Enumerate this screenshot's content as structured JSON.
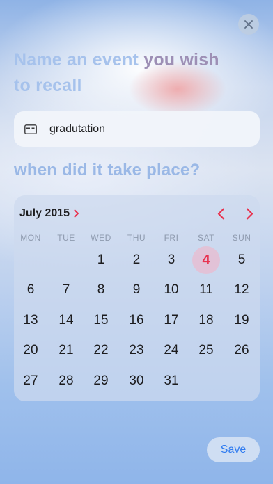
{
  "header": {
    "title_part1": "Name an event ",
    "title_part2": "you wish",
    "title_part3": "to recall"
  },
  "event_input": {
    "value": "gradutation",
    "icon": "id-card-icon"
  },
  "date_prompt": "when did it take place?",
  "calendar": {
    "month_label": "July 2015",
    "weekdays": [
      "MON",
      "TUE",
      "WED",
      "THU",
      "FRI",
      "SAT",
      "SUN"
    ],
    "weeks": [
      [
        "",
        "",
        "1",
        "2",
        "3",
        "4",
        "5"
      ],
      [
        "6",
        "7",
        "8",
        "9",
        "10",
        "11",
        "12"
      ],
      [
        "13",
        "14",
        "15",
        "16",
        "17",
        "18",
        "19"
      ],
      [
        "20",
        "21",
        "22",
        "23",
        "24",
        "25",
        "26"
      ],
      [
        "27",
        "28",
        "29",
        "30",
        "31",
        "",
        ""
      ]
    ],
    "selected_day": "4",
    "accent_color": "#e8324f"
  },
  "actions": {
    "save_label": "Save"
  }
}
